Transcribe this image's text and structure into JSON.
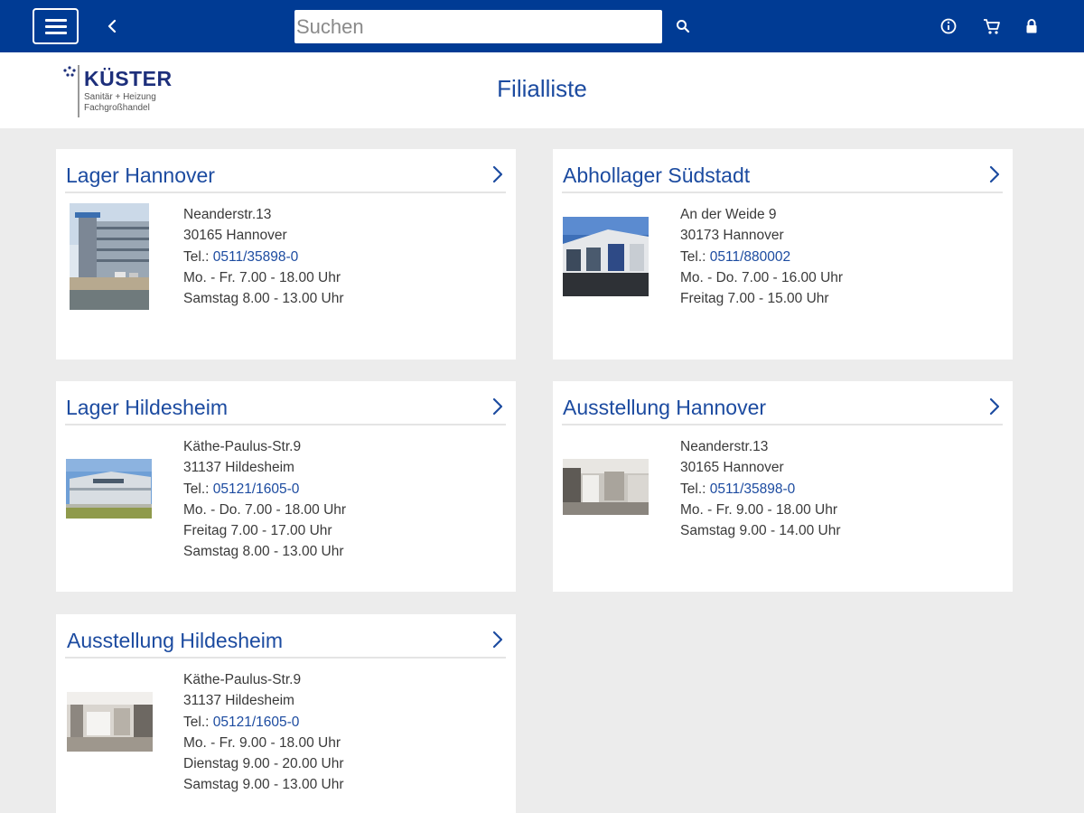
{
  "topbar": {
    "search_placeholder": "Suchen",
    "icons": {
      "menu": "hamburger-menu-icon",
      "back": "chevron-left-icon",
      "search": "search-icon",
      "info": "info-icon",
      "cart": "cart-icon",
      "lock": "lock-icon"
    },
    "colors": {
      "bar": "#003b94",
      "icon": "#ffffff"
    }
  },
  "header": {
    "logo_brand": "KÜSTER",
    "logo_line1": "Sanitär + Heizung",
    "logo_line2": "Fachgroßhandel",
    "title": "Filialliste"
  },
  "colors": {
    "accent": "#1c4ba0",
    "background": "#ececec",
    "card": "#ffffff"
  },
  "branches": [
    {
      "name": "Lager Hannover",
      "street": "Neanderstr.13",
      "city": "30165 Hannover",
      "tel_label": "Tel.:",
      "tel": "0511/35898-0",
      "hours": [
        "Mo. - Fr. 7.00 - 18.00 Uhr",
        "Samstag 8.00 - 13.00 Uhr"
      ]
    },
    {
      "name": "Abhollager Südstadt",
      "street": "An der Weide 9",
      "city": "30173 Hannover",
      "tel_label": "Tel.:",
      "tel": "0511/880002",
      "hours": [
        "Mo. - Do. 7.00 - 16.00 Uhr",
        "Freitag 7.00 - 15.00 Uhr"
      ]
    },
    {
      "name": "Lager Hildesheim",
      "street": "Käthe-Paulus-Str.9",
      "city": "31137 Hildesheim",
      "tel_label": "Tel.:",
      "tel": "05121/1605-0",
      "hours": [
        "Mo. - Do. 7.00 - 18.00 Uhr",
        "Freitag 7.00 - 17.00 Uhr",
        "Samstag 8.00 - 13.00 Uhr"
      ]
    },
    {
      "name": "Ausstellung Hannover",
      "street": "Neanderstr.13",
      "city": "30165 Hannover",
      "tel_label": "Tel.:",
      "tel": "0511/35898-0",
      "hours": [
        "Mo. - Fr. 9.00 - 18.00 Uhr",
        "Samstag 9.00 - 14.00 Uhr"
      ]
    },
    {
      "name": "Ausstellung Hildesheim",
      "street": "Käthe-Paulus-Str.9",
      "city": "31137 Hildesheim",
      "tel_label": "Tel.:",
      "tel": "05121/1605-0",
      "hours": [
        "Mo. - Fr. 9.00 - 18.00 Uhr",
        "Dienstag 9.00 - 20.00 Uhr",
        "Samstag 9.00 - 13.00 Uhr"
      ]
    }
  ]
}
